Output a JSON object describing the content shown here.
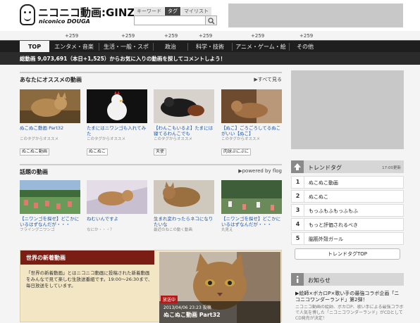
{
  "logo": {
    "main": "ニコニコ動画:GINZA",
    "sub": "niconico DOUGA"
  },
  "search": {
    "tabs": [
      "キーワード",
      "タグ",
      "マイリスト"
    ],
    "active_tab": "タグ"
  },
  "nav": {
    "counts": [
      "+259",
      "+259",
      "+259",
      "+259",
      "+259",
      "+259"
    ],
    "items": [
      "TOP",
      "エンタメ・音楽",
      "生活・一般・スポ",
      "政治",
      "科学・技術",
      "アニメ・ゲーム・絵",
      "その他"
    ]
  },
  "stats": {
    "text": "総動画 9,073,691（本日+1,525）からお気に入りの動画を探してコメントしよう！"
  },
  "recommend": {
    "title": "あなたにオススメの動画",
    "link": "▶すべて見る",
    "cards": [
      {
        "title": "ぬこぬこ動画 Part32",
        "sub": "このタグからオススメ",
        "tag": "ぬこぬこ動画"
      },
      {
        "title": "たまにはニワンゴも入れてみた",
        "sub": "このタグからオススメ",
        "tag": "ぬこぬこ"
      },
      {
        "title": "【わんこもいるよ】たまには寝てるわんこでも",
        "sub": "このタグからオススメ",
        "tag": "天使"
      },
      {
        "title": "【ぬこ】ごろごろしてるぬこがいい【ぬこ】",
        "sub": "このタグからオススメ",
        "tag": "肉球ぷにぷに"
      }
    ]
  },
  "topics": {
    "title": "話題の動画",
    "link": "▶powered by  flog",
    "cards": [
      {
        "title": "【ニワンゴを探せ】どこかにいるはずなんだが・・・",
        "sub": "フライングニワンゴ"
      },
      {
        "title": "ねむいんですよ",
        "sub": "なにか・・・？"
      },
      {
        "title": "生まれ変わったらネコになりたいな",
        "sub": "最近のねこの動く動画"
      },
      {
        "title": "【ニワンゴを探せ】どこかにいるはずなんだが・・・",
        "sub": "丸見え"
      }
    ]
  },
  "world": {
    "title": "世界の新着動画",
    "desc": "「世界の新着動画」とはニコニコ動画に投稿された新着動画をみんなで見て楽しむ生放送番組です。19:00〜26:30まで、毎日放送をしています。",
    "badge": "放送中",
    "date": "2013/04/06 23:23 投稿",
    "video_title": "ぬこぬこ動画 Part32"
  },
  "trend": {
    "title": "トレンドタグ",
    "updated": "17:00更新",
    "items": [
      {
        "num": "1",
        "label": "ぬこぬこ動画"
      },
      {
        "num": "2",
        "label": "ぬこぬこ"
      },
      {
        "num": "3",
        "label": "もっふもふもっふもふ"
      },
      {
        "num": "4",
        "label": "もっと評価されるべき"
      },
      {
        "num": "5",
        "label": "脳筋外殻ガール"
      }
    ],
    "top_button": "トレンドタグTOP"
  },
  "notice": {
    "title": "お知らせ",
    "headline": "▶絵師×ボカロP×歌い手の最強コラボ企画「ニコニコワンダーランド」第2弾！",
    "body": "ニコニコ動画の絵師、ボカロP、歌い手による最強コラボで人気を博した「ニコニコワンダーランド」がCDとしてCD発売が決定！"
  },
  "colors": {
    "nav_bg": "#1e1e1e",
    "link": "#1a56b0",
    "world_header": "#7a1d14",
    "ad": "#c8c8c8"
  }
}
